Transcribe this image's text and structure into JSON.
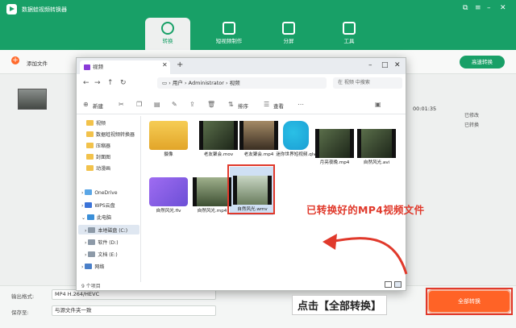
{
  "app": {
    "title": "数据蛙视频转换器",
    "win_controls": [
      "⧉",
      "≡",
      "–",
      "✕"
    ]
  },
  "nav_tabs": [
    {
      "label": "转换",
      "icon": "convert-icon",
      "active": true
    },
    {
      "label": "短视频制作",
      "icon": "image-icon",
      "active": false
    },
    {
      "label": "分屏",
      "icon": "grid-icon",
      "active": false
    },
    {
      "label": "工具",
      "icon": "toolbox-icon",
      "active": false
    }
  ],
  "toolbar": {
    "add_file_label": "添加文件",
    "fast_convert_label": "高速转换"
  },
  "video_row": {
    "duration": "00:01:35",
    "edit_label": "已修改",
    "convert_label": "已转换"
  },
  "bottom": {
    "output_format_label": "输出格式:",
    "output_format_value": "MP4 H.264/HEVC",
    "save_to_label": "保存至:",
    "save_to_value": "与源文件夹一致",
    "convert_all_label": "全部转换"
  },
  "dialog": {
    "tab_title": "视频",
    "path": [
      "用户",
      "Administrator",
      "视频"
    ],
    "search_placeholder": "在 视频 中搜索",
    "commands": {
      "new": "新建",
      "sort": "排序",
      "view": "查看"
    },
    "nav_items": [
      "视频",
      "数据蛙视频转换器",
      "压缩器",
      "封面图",
      "动漫画",
      "OneDrive",
      "WPS云盘",
      "此电脑",
      "本地磁盘 (C:)",
      "软件 (D:)",
      "文档 (E:)",
      "网络"
    ],
    "files": [
      {
        "name": "摄像",
        "kind": "folder"
      },
      {
        "name": "老友聚会.mov",
        "kind": "video"
      },
      {
        "name": "老友聚会.mp4",
        "kind": "video"
      },
      {
        "name": "迷你世界短视频.qlv",
        "kind": "app"
      },
      {
        "name": "月亮夜晚.mp4",
        "kind": "video"
      },
      {
        "name": "自然风光.avi",
        "kind": "video"
      },
      {
        "name": "自然风光.flv",
        "kind": "purple"
      },
      {
        "name": "自然风光.mp4",
        "kind": "video"
      },
      {
        "name": "自然风光.wmv",
        "kind": "selected"
      }
    ],
    "status": "9 个项目"
  },
  "annotations": {
    "converted_note": "已转换好的MP4视频文件",
    "click_note": "点击【全部转换】"
  },
  "colors": {
    "brand": "#18a067",
    "accent": "#ff6326",
    "annotation": "#e0392b"
  }
}
